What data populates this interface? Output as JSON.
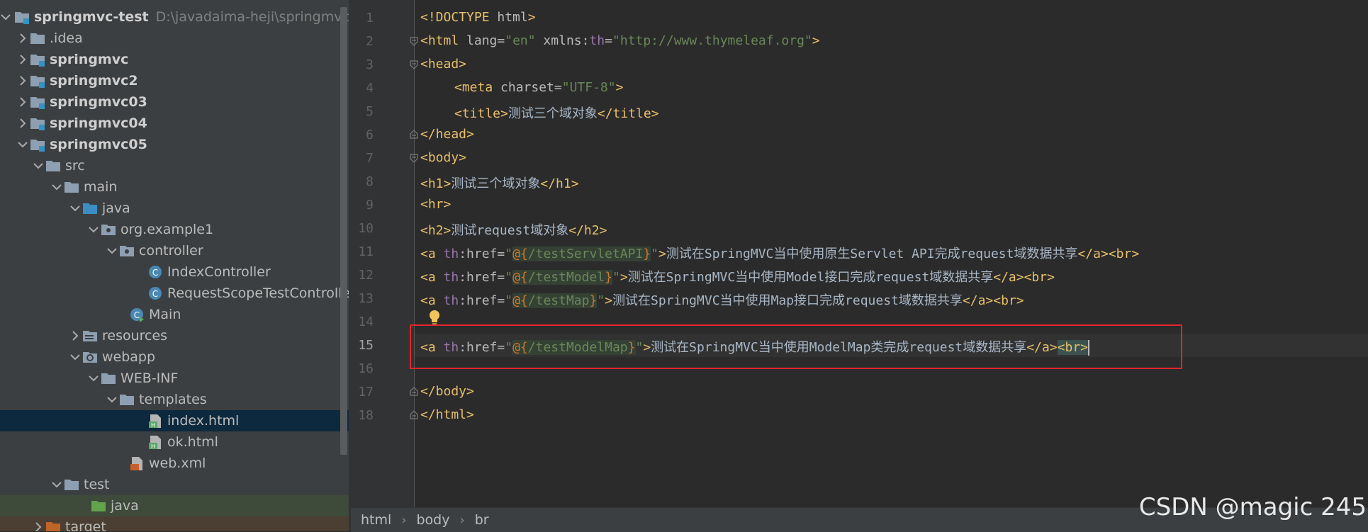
{
  "project": {
    "name": "springmvc-test",
    "path": "D:\\javadaima-heji\\springmvc-test"
  },
  "tree": [
    {
      "label": ".idea"
    },
    {
      "label": "springmvc"
    },
    {
      "label": "springmvc2"
    },
    {
      "label": "springmvc03"
    },
    {
      "label": "springmvc04"
    },
    {
      "label": "springmvc05"
    },
    {
      "label": "src"
    },
    {
      "label": "main"
    },
    {
      "label": "java"
    },
    {
      "label": "org.example1"
    },
    {
      "label": "controller"
    },
    {
      "label": "IndexController"
    },
    {
      "label": "RequestScopeTestController"
    },
    {
      "label": "Main"
    },
    {
      "label": "resources"
    },
    {
      "label": "webapp"
    },
    {
      "label": "WEB-INF"
    },
    {
      "label": "templates"
    },
    {
      "label": "index.html"
    },
    {
      "label": "ok.html"
    },
    {
      "label": "web.xml"
    },
    {
      "label": "test"
    },
    {
      "label": "java"
    },
    {
      "label": "target"
    }
  ],
  "line_numbers": [
    "1",
    "2",
    "3",
    "4",
    "5",
    "6",
    "7",
    "8",
    "9",
    "10",
    "11",
    "12",
    "13",
    "14",
    "15",
    "16",
    "17",
    "18"
  ],
  "code": {
    "l1": {
      "a": "<!DOCTYPE ",
      "b": "html",
      "c": ">"
    },
    "l2": {
      "a": "<html ",
      "b": "lang",
      "c": "=",
      "d": "\"en\"",
      "e": " xmlns",
      "f": ":",
      "g": "th",
      "h": "=",
      "i": "\"http://www.thymeleaf.org\"",
      "j": ">"
    },
    "l3": "<head>",
    "l4": {
      "a": "<meta ",
      "b": "charset",
      "c": "=",
      "d": "\"UTF-8\"",
      "e": ">"
    },
    "l5": {
      "a": "<title>",
      "b": "测试三个域对象",
      "c": "</title>"
    },
    "l6": "</head>",
    "l7": "<body>",
    "l8": {
      "a": "<h1>",
      "b": "测试三个域对象",
      "c": "</h1>"
    },
    "l9": "<hr>",
    "l10": {
      "a": "<h2>",
      "b": "测试request域对象",
      "c": "</h2>"
    },
    "l11": {
      "a": "<a ",
      "ns": "th",
      "b": ":href",
      "c": "=",
      "q1": "\"",
      "e1": "@{",
      "p": "/testServletAPI",
      "e2": "}",
      "q2": "\"",
      "d": ">",
      "t": "测试在SpringMVC当中使用原生Servlet API完成request域数据共享",
      "end": "</a><br>"
    },
    "l12": {
      "a": "<a ",
      "ns": "th",
      "b": ":href",
      "c": "=",
      "q1": "\"",
      "e1": "@{",
      "p": "/testModel",
      "e2": "}",
      "q2": "\"",
      "d": ">",
      "t": "测试在SpringMVC当中使用Model接口完成request域数据共享",
      "end": "</a><br>"
    },
    "l13": {
      "a": "<a ",
      "ns": "th",
      "b": ":href",
      "c": "=",
      "q1": "\"",
      "e1": "@{",
      "p": "/testMap",
      "e2": "}",
      "q2": "\"",
      "d": ">",
      "t": "测试在SpringMVC当中使用Map接口完成request域数据共享",
      "end": "</a><br>"
    },
    "l15": {
      "a": "<a ",
      "ns": "th",
      "b": ":href",
      "c": "=",
      "q1": "\"",
      "e1": "@{",
      "p": "/testModelMap",
      "e2": "}",
      "q2": "\"",
      "d": ">",
      "t": "测试在SpringMVC当中使用ModelMap类完成request域数据共享",
      "end": "</a>",
      "br": "<br>"
    },
    "l17": "</body>",
    "l18": "</html>"
  },
  "breadcrumb": [
    "html",
    "body",
    "br"
  ],
  "watermark": "CSDN @magic 245",
  "colors": {
    "accent_red_box": "#e0262e",
    "tag": "#e8bf6a",
    "string": "#6a8759",
    "attr_ns": "#9876aa"
  }
}
